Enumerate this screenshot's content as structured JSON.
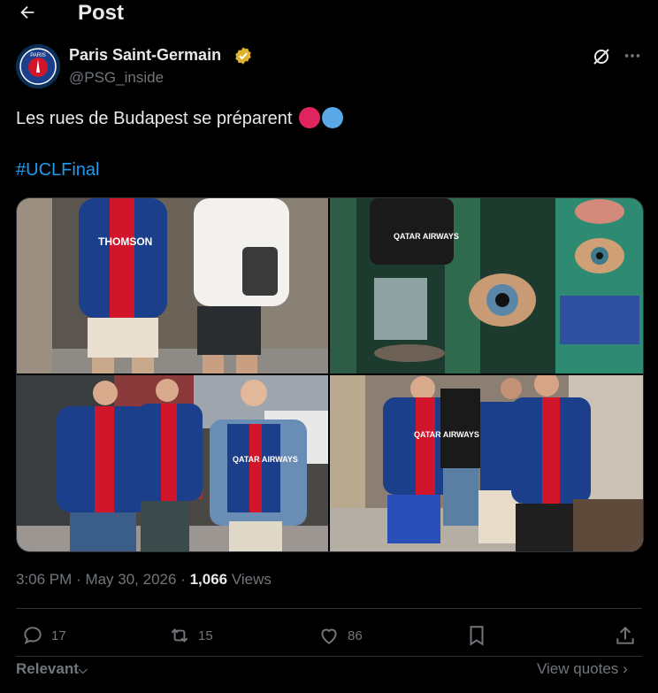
{
  "header": {
    "title": "Post"
  },
  "author": {
    "name": "Paris Saint-Germain",
    "handle": "@PSG_inside",
    "avatar_text": "PARIS"
  },
  "post": {
    "text": "Les rues de Budapest se préparent",
    "hashtag": "#UCLFinal"
  },
  "photos": [
    {
      "caption": "THOMSON"
    },
    {
      "caption": "QATAR AIRWAYS"
    },
    {
      "caption": "QATAR AIRWAYS"
    },
    {
      "caption": "QATAR AIRWAYS"
    }
  ],
  "meta": {
    "time": "3:06 PM",
    "date": "May 30, 2026",
    "views": "1,066",
    "views_label": "Views"
  },
  "actions": {
    "replies": "17",
    "reposts": "15",
    "likes": "86"
  },
  "footer": {
    "sort_label": "Relevant",
    "quotes_label": "View quotes"
  },
  "colors": {
    "accent": "#1d9bf0",
    "verified": "#e0b12b",
    "red_dot": "#e0245e",
    "blue_dot": "#5aa9e6",
    "psg_navy": "#1c3f8c",
    "psg_red": "#d1162b"
  }
}
